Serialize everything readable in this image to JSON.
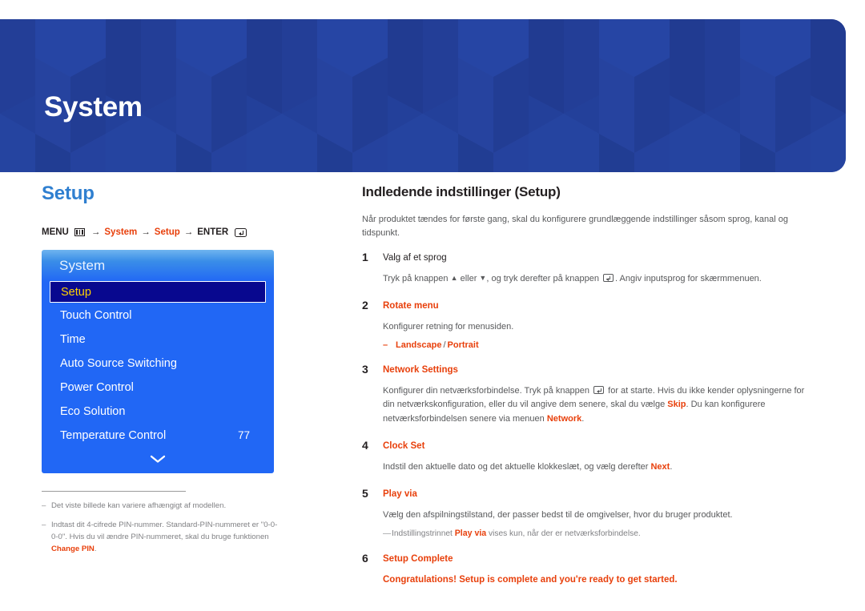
{
  "banner": {
    "title": "System",
    "bg_color": "#23409a"
  },
  "left": {
    "section_title": "Setup",
    "breadcrumb": {
      "menu_label": "MENU",
      "menu_icon": "menu-grid-icon",
      "arrow": "→",
      "item1": "System",
      "item2": "Setup",
      "enter_label": "ENTER",
      "enter_icon": "enter-return-icon"
    },
    "osd": {
      "header": "System",
      "items": [
        {
          "label": "Setup",
          "value": "",
          "selected": true
        },
        {
          "label": "Touch Control",
          "value": "",
          "selected": false
        },
        {
          "label": "Time",
          "value": "",
          "selected": false
        },
        {
          "label": "Auto Source Switching",
          "value": "",
          "selected": false
        },
        {
          "label": "Power Control",
          "value": "",
          "selected": false
        },
        {
          "label": "Eco Solution",
          "value": "",
          "selected": false
        },
        {
          "label": "Temperature Control",
          "value": "77",
          "selected": false
        }
      ],
      "scroll_icon": "chevron-down-icon",
      "accent_selected_text": "#ffd200",
      "panel_color": "#2167f5"
    },
    "footnotes": [
      {
        "dash": "–",
        "text": "Det viste billede kan variere afhængigt af modellen.",
        "emphasis": "",
        "tail": ""
      },
      {
        "dash": "–",
        "text": "Indtast dit 4-cifrede PIN-nummer. Standard-PIN-nummeret er \"0-0-0-0\". Hvis du vil ændre PIN-nummeret, skal du bruge funktionen ",
        "emphasis": "Change PIN",
        "tail": "."
      }
    ]
  },
  "right": {
    "title": "Indledende indstillinger (Setup)",
    "intro": "Når produktet tændes for første gang, skal du konfigurere grundlæggende indstillinger såsom sprog, kanal og tidspunkt.",
    "steps": [
      {
        "num": "1",
        "head": "Valg af et sprog",
        "head_red": false,
        "text_a": "Tryk på knappen ",
        "text_b": " eller ",
        "text_c": ", og tryk derefter på knappen ",
        "text_d": ". Angiv inputsprog for skærmmenuen.",
        "up_glyph": "▲",
        "down_glyph": "▼"
      },
      {
        "num": "2",
        "head": "Rotate menu",
        "head_red": true,
        "text": "Konfigurer retning for menusiden.",
        "bullet_dash": "–",
        "bullet_a": "Landscape",
        "bullet_slash": "/",
        "bullet_b": "Portrait"
      },
      {
        "num": "3",
        "head": "Network Settings",
        "head_red": true,
        "text_a": "Konfigurer din netværksforbindelse. Tryk på knappen ",
        "text_b": " for at starte. Hvis du ikke kender oplysningerne for din netværkskonfiguration, eller du vil angive dem senere, skal du vælge ",
        "hl1": "Skip",
        "text_c": ". Du kan konfigurere netværksforbindelsen senere via menuen ",
        "hl2": "Network",
        "text_d": "."
      },
      {
        "num": "4",
        "head": "Clock Set",
        "head_red": true,
        "text_a": "Indstil den aktuelle dato og det aktuelle klokkeslæt, og vælg derefter ",
        "hl1": "Next",
        "text_b": "."
      },
      {
        "num": "5",
        "head": "Play via",
        "head_red": true,
        "text": "Vælg den afspilningstilstand, der passer bedst til de omgivelser, hvor du bruger produktet.",
        "note_dash": "—",
        "note_a": "Indstillingstrinnet ",
        "note_hl": "Play via",
        "note_b": " vises kun, når der er netværksforbindelse."
      },
      {
        "num": "6",
        "head": "Setup Complete",
        "head_red": true,
        "final": "Congratulations! Setup is complete and you're ready to get started."
      }
    ]
  },
  "colors": {
    "accent_red": "#e8400c",
    "heading_blue": "#2f7fd0",
    "banner_blue": "#23409a"
  }
}
